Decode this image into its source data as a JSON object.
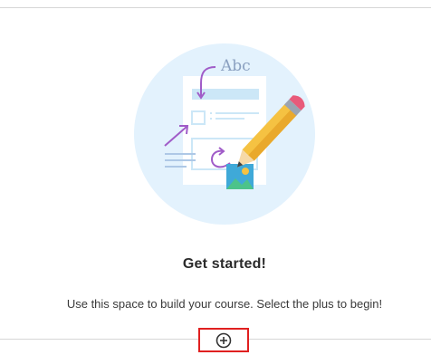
{
  "empty_state": {
    "illustration_label": "Abc",
    "heading": "Get started!",
    "message": "Use this space to build your course. Select the plus to begin!",
    "illustration_icon": "document-pencil-icon"
  },
  "actions": {
    "add_icon": "plus-circle-icon"
  },
  "colors": {
    "circle_bg": "#e3f2fd",
    "accent_purple": "#a05cc8",
    "pencil_yellow": "#f5c242",
    "pencil_pink": "#e85a7a",
    "highlight_border": "#e02020"
  }
}
